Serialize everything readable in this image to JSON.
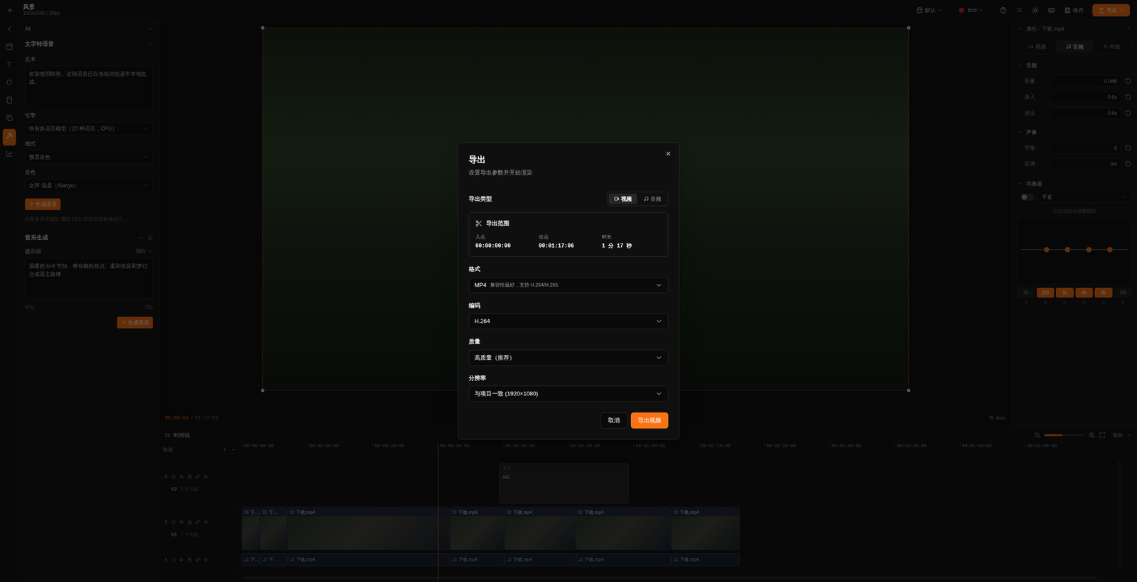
{
  "topbar": {
    "title": "风景",
    "meta": "1920x1080 | 30fps",
    "layout": "默认",
    "user": "tmd",
    "save": "保存",
    "export": "导出"
  },
  "rail": [
    {
      "selected": false
    },
    {
      "selected": false
    },
    {
      "selected": false
    },
    {
      "selected": false
    },
    {
      "selected": false
    },
    {
      "selected": false
    },
    {
      "selected": true
    },
    {
      "selected": false
    }
  ],
  "left": {
    "header": "AI",
    "tts": {
      "title": "文字转语音",
      "text_label": "文本",
      "text": "欢迎使用快剪。这段语音已在当前浏览器中本地生成。",
      "engine_label": "引擎",
      "engine": "快剪多语言模型（20 种语言，CPU）",
      "mode_label": "模式",
      "mode": "预置音色",
      "voice_label": "音色",
      "voice": "女声·温柔（Xiaoyu）",
      "button": "生成语音",
      "note": "快剪多语言模型 通过 CPU 在浏览器本地运行。"
    },
    "music": {
      "title": "音乐生成",
      "prompt_label": "提示词",
      "preset": "随机",
      "prompt": "温暖的 lo-fi 节拍，带有颗粒鼓点、柔和低音和梦幻合成器主旋律",
      "duration_label": "时长",
      "duration": "30s",
      "button": "生成音乐"
    }
  },
  "preview": {
    "current": "00:30:01",
    "separator": "/",
    "total": "01:17:06",
    "zoom": "Auto"
  },
  "inspector": {
    "title": "属性 - 下载.mp4",
    "tabs": [
      {
        "label": "视频",
        "selected": false
      },
      {
        "label": "音频",
        "selected": true
      },
      {
        "label": "特效",
        "selected": false
      }
    ],
    "sections": [
      {
        "title": "音频",
        "rows": [
          {
            "label": "音量",
            "value": "0.0dB"
          },
          {
            "label": "淡入",
            "value": "0.0s"
          },
          {
            "label": "淡出",
            "value": "0.0s"
          }
        ]
      },
      {
        "title": "声像",
        "rows": [
          {
            "label": "平衡",
            "value": "0"
          },
          {
            "label": "音调",
            "value": "0st"
          }
        ]
      }
    ],
    "eq": {
      "title": "均衡器",
      "enabled": false,
      "preset": "平直",
      "hint": "点击或拖动调整频段",
      "bands": [
        {
          "freq": "60",
          "gain": "0",
          "selected": false
        },
        {
          "freq": "250",
          "gain": "0",
          "selected": true
        },
        {
          "freq": "1k",
          "gain": "0",
          "selected": true
        },
        {
          "freq": "4k",
          "gain": "0",
          "selected": true
        },
        {
          "freq": "8k",
          "gain": "0",
          "selected": true
        },
        {
          "freq": "16k",
          "gain": "0",
          "selected": false
        }
      ]
    }
  },
  "timeline": {
    "title": "时间线",
    "tracks_label": "轨道",
    "add": "+",
    "remove": "−",
    "snap": "吸附",
    "zoom": 0.45,
    "meter_level": 0,
    "ruler": [
      "00:00:00:00",
      "00:00:10:00",
      "00:00:20:00",
      "00:00:30:00",
      "00:00:40:00",
      "00:00:50:00",
      "00:01:00:00",
      "00:01:10:00",
      "00:01:20:00",
      "00:01:30:00",
      "00:01:40:00",
      "00:01:50:00",
      "00:02:00:00"
    ],
    "tracks": [
      {
        "name": "V2",
        "count": "1 个片段",
        "kind": "text",
        "linked": true,
        "clips": [
          {
            "label": "H1",
            "sub": "文字"
          }
        ]
      },
      {
        "name": "V1",
        "count": "7 个片段",
        "kind": "video",
        "linked": true,
        "clips": [
          {
            "label": "下…"
          },
          {
            "label": "下…"
          },
          {
            "label": "下载.mp4"
          },
          {
            "label": "下载.mp4"
          },
          {
            "label": "下载.mp4"
          },
          {
            "label": "下载.mp4"
          },
          {
            "label": "下载.mp4"
          }
        ]
      },
      {
        "kind": "audio",
        "linked": true,
        "clips": [
          {
            "label": "下…"
          },
          {
            "label": "下…"
          },
          {
            "label": "下载.mp4"
          },
          {
            "label": "下载.mp4"
          },
          {
            "label": "下载.mp4"
          },
          {
            "label": "下载.mp4"
          },
          {
            "label": "下载.mp4"
          }
        ]
      }
    ]
  },
  "dialog": {
    "title": "导出",
    "subtitle": "设置导出参数并开始渲染",
    "close": "×",
    "type_label": "导出类型",
    "types": [
      {
        "label": "视频",
        "selected": true
      },
      {
        "label": "音频",
        "selected": false
      }
    ],
    "range": {
      "title": "导出范围",
      "fields": [
        {
          "label": "入点",
          "value": "00:00:00:00"
        },
        {
          "label": "出点",
          "value": "00:01:17:06"
        },
        {
          "label": "时长",
          "value": "1 分 17 秒"
        }
      ]
    },
    "fields": [
      {
        "label": "格式",
        "value": "MP4",
        "hint": "兼容性最好，支持 H.264/H.265"
      },
      {
        "label": "编码",
        "value": "H.264"
      },
      {
        "label": "质量",
        "value": "高质量（推荐）"
      },
      {
        "label": "分辨率",
        "value": "与项目一致 (1920×1080)"
      }
    ],
    "cancel": "取消",
    "confirm": "导出视频"
  }
}
